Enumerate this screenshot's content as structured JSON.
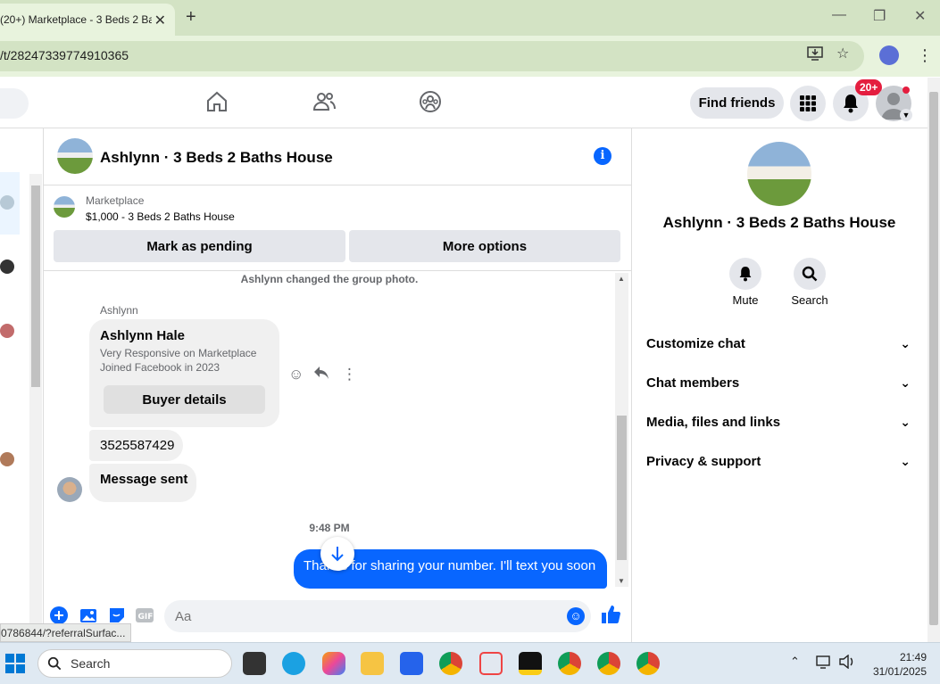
{
  "browser": {
    "tab_title": "(20+) Marketplace - 3 Beds 2 Ba",
    "url": "/t/28247339774910365"
  },
  "header": {
    "find_friends": "Find friends",
    "notification_count": "20+"
  },
  "chat": {
    "title": "Ashlynn · 3 Beds 2 Baths House",
    "marketplace_label": "Marketplace",
    "listing": "$1,000 - 3 Beds 2 Baths House",
    "mark_pending": "Mark as pending",
    "more_options": "More options",
    "system_message": "Ashlynn changed the group photo.",
    "sender": "Ashlynn",
    "card_name": "Ashlynn Hale",
    "card_line1": "Very Responsive on Marketplace",
    "card_line2": "Joined Facebook in 2023",
    "buyer_details": "Buyer details",
    "phone": "3525587429",
    "message_sent": "Message sent",
    "timestamp": "9:48 PM",
    "outgoing": "Thanks for sharing your number. I'll text you soon",
    "input_placeholder": "Aa",
    "status_url": "0786844/?referralSurfac..."
  },
  "right_panel": {
    "title": "Ashlynn · 3 Beds 2 Baths House",
    "mute": "Mute",
    "search": "Search",
    "menu": [
      {
        "label": "Customize chat"
      },
      {
        "label": "Chat members"
      },
      {
        "label": "Media, files and links"
      },
      {
        "label": "Privacy & support"
      }
    ]
  },
  "taskbar": {
    "search_label": "Search",
    "time": "21:49",
    "date": "31/01/2025"
  },
  "colors": {
    "accent": "#0866ff",
    "badge": "#e41e3f",
    "tab_bg": "#d3e3c4"
  }
}
